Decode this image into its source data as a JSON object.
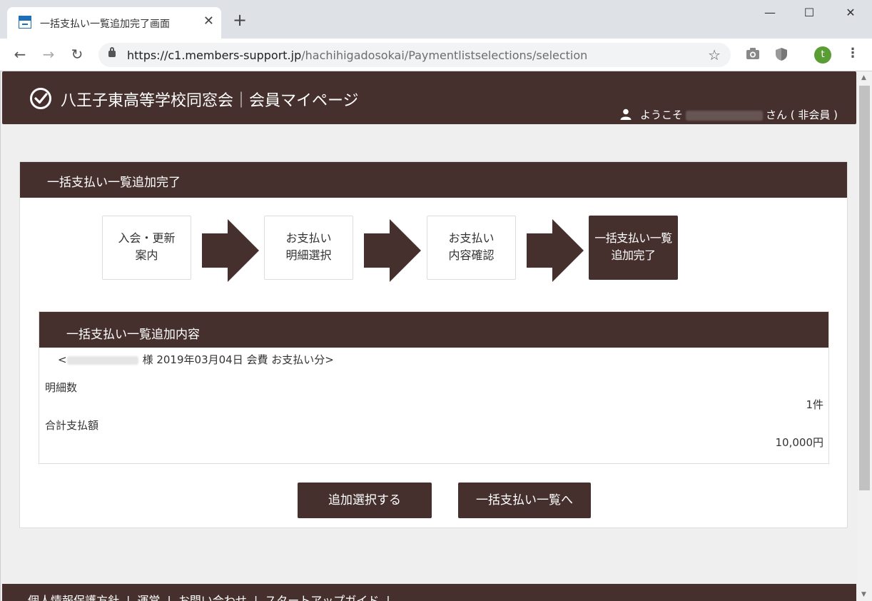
{
  "browser": {
    "tab_title": "一括支払い一覧追加完了画面",
    "tab_close": "✕",
    "new_tab": "+",
    "url_host": "https://c1.members-support.jp",
    "url_path": "/hachihigadosokai/Paymentlistselections/selection",
    "profile_initial": "t",
    "window_min": "—",
    "window_max": "☐",
    "window_close": "✕",
    "icons": [
      "back-icon",
      "forward-icon",
      "reload-icon",
      "lock-icon",
      "star-icon",
      "camera-icon",
      "shield-icon",
      "menu-icon"
    ]
  },
  "header": {
    "site_title": "八王子東高等学校同窓会｜会員マイページ",
    "welcome_prefix": "ようこそ",
    "welcome_suffix": "さん ( 非会員 )"
  },
  "card": {
    "title": "一括支払い一覧追加完了"
  },
  "steps": [
    {
      "line1": "入会・更新",
      "line2": "案内",
      "active": false
    },
    {
      "line1": "お支払い",
      "line2": "明細選択",
      "active": false
    },
    {
      "line1": "お支払い",
      "line2": "内容確認",
      "active": false
    },
    {
      "line1": "一括支払い一覧",
      "line2": "追加完了",
      "active": true
    }
  ],
  "panel": {
    "title": "一括支払い一覧追加内容",
    "open_bracket": "<",
    "subtitle": "様 2019年03月04日 会費 お支払い分>",
    "count_label": "明細数",
    "count_value": "1件",
    "total_label": "合計支払額",
    "total_value": "10,000円"
  },
  "buttons": {
    "add_more": "追加選択する",
    "to_list": "一括支払い一覧へ"
  },
  "footer": {
    "links": [
      "個人情報保護方針",
      "運営",
      "お問い合わせ",
      "スタートアップガイド"
    ]
  },
  "colors": {
    "brand": "#46302e",
    "page_bg": "#efefef"
  }
}
